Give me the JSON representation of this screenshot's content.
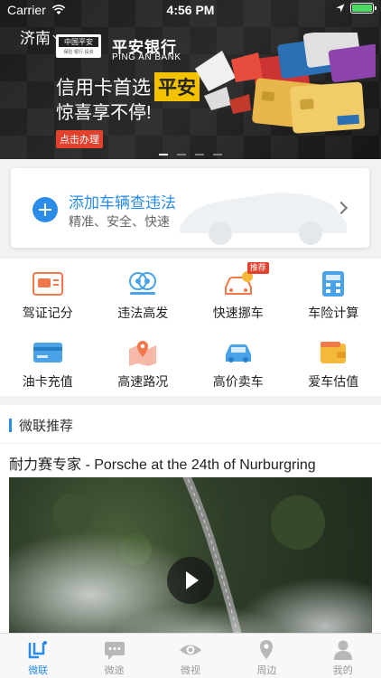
{
  "status_bar": {
    "carrier": "Carrier",
    "time": "4:56 PM"
  },
  "banner": {
    "city": "济南",
    "logo_text": "中国平安",
    "logo_sub": "保险·银行·投资",
    "bank_name_cn": "平安银行",
    "bank_name_en": "PING AN BANK",
    "promo_line1": "信用卡首选",
    "promo_highlight": "平安",
    "promo_line2": "惊喜享不停!",
    "cta": "点击办理",
    "page_count": 4,
    "active_page": 1
  },
  "add_vehicle": {
    "title": "添加车辆查违法",
    "subtitle": "精准、安全、快速"
  },
  "services": [
    {
      "label": "驾证记分",
      "icon": "license-icon"
    },
    {
      "label": "违法高发",
      "icon": "camera-icon"
    },
    {
      "label": "快速挪车",
      "icon": "car-move-icon",
      "badge": "推荐"
    },
    {
      "label": "车险计算",
      "icon": "calculator-icon"
    },
    {
      "label": "油卡充值",
      "icon": "fuel-card-icon"
    },
    {
      "label": "高速路况",
      "icon": "map-pin-icon"
    },
    {
      "label": "高价卖车",
      "icon": "car-sale-icon"
    },
    {
      "label": "爱车估值",
      "icon": "wallet-icon"
    }
  ],
  "feed": {
    "section_title": "微联推荐",
    "video_title": "耐力赛专家 - Porsche at the 24th of Nurburgring"
  },
  "tabbar": [
    {
      "label": "微联",
      "icon": "home-icon",
      "active": true
    },
    {
      "label": "微途",
      "icon": "chat-icon",
      "active": false
    },
    {
      "label": "微视",
      "icon": "eye-icon",
      "active": false
    },
    {
      "label": "周边",
      "icon": "location-icon",
      "active": false
    },
    {
      "label": "我的",
      "icon": "person-icon",
      "active": false
    }
  ],
  "colors": {
    "accent": "#2a8be8",
    "promo_red": "#e2412d",
    "highlight_yellow": "#f2c200"
  }
}
